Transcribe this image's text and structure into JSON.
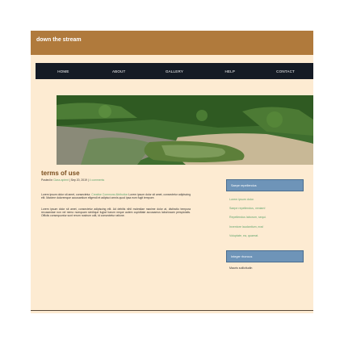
{
  "site": {
    "title": "down the stream"
  },
  "nav": [
    {
      "label": "HOME"
    },
    {
      "label": "ABOUT"
    },
    {
      "label": "GALLERY"
    },
    {
      "label": "HELP"
    },
    {
      "label": "CONTACT"
    }
  ],
  "post": {
    "title": "terms of use",
    "meta_prefix": "Posted in",
    "category": "Class aptent",
    "date": "Sep 20, 2019",
    "comments": "4 comments",
    "p1_a": "Lorem ipsum dolor sit amet, consectetur.",
    "p1_link": "Creative Commons Attribution",
    "p1_b": "Lorem ipsum dolor sit amet, consectetur adipiscing elit. Maxime doloremque accusantium eligendi et adipisci omnis quod ipsa eum fugit tempore.",
    "p2": "Lorem ipsum dolor sit amet, consectetur adipiscing elit. Ad debitis nihil molestiae maxime dolor at, distinctio tempora recusandae non vel nemo numquam similique fugiat harum neque autem cupiditate accusamus laboriosam perspiciatis. Officiis consequuntur sunt rerum nostrum odit, id consectetur ratione."
  },
  "sidebar": {
    "button1": "Saepe repellendus",
    "links": [
      "Lorem ipsum dolor.",
      "Saepe repellendus, veniam!",
      "Repellendus laborum, sequi.",
      "Inventore laudantium, eos!",
      "Voluptate, ea, quaerat."
    ],
    "button2": "Integer rhoncus",
    "items": [
      "Mauris sollicitudin"
    ]
  },
  "hero": {
    "alt": "stream photo"
  }
}
